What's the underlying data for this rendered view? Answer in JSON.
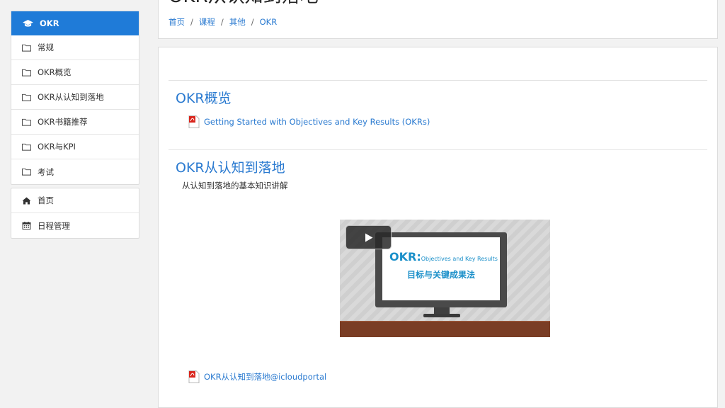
{
  "sidebar": {
    "course_item": {
      "label": "OKR",
      "icon": "graduation-cap-icon"
    },
    "sections": [
      {
        "label": "常规",
        "icon": "folder-icon"
      },
      {
        "label": "OKR概览",
        "icon": "folder-icon"
      },
      {
        "label": "OKR从认知到落地",
        "icon": "folder-icon"
      },
      {
        "label": "OKR书籍推荐",
        "icon": "folder-icon"
      },
      {
        "label": "OKR与KPI",
        "icon": "folder-icon"
      },
      {
        "label": "考试",
        "icon": "folder-icon"
      }
    ],
    "links": [
      {
        "label": "首页",
        "icon": "home-icon"
      },
      {
        "label": "日程管理",
        "icon": "calendar-icon"
      }
    ]
  },
  "header": {
    "title": "OKR从认知到落地",
    "breadcrumb": [
      "首页",
      "课程",
      "其他",
      "OKR"
    ]
  },
  "main": {
    "sections": [
      {
        "title": "OKR概览",
        "resources": [
          {
            "label": "Getting Started with Objectives and Key Results (OKRs)",
            "icon": "pdf-icon"
          }
        ]
      },
      {
        "title": "OKR从认知到落地",
        "description": "从认知到落地的基本知识讲解",
        "video": {
          "screen_title": "OKR:",
          "screen_subtitle": "Objectives and Key Results",
          "screen_caption": "目标与关键成果法"
        },
        "resources": [
          {
            "label": "OKR从认知到落地@icloudportal",
            "icon": "pdf-icon"
          }
        ]
      }
    ]
  },
  "colors": {
    "accent": "#1f7bd8",
    "link": "#2a7ad0",
    "page_bg": "#f2f2f2"
  }
}
